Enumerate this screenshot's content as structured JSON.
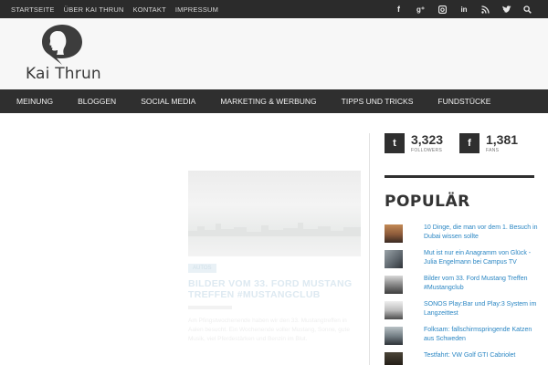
{
  "topbar": {
    "links": [
      "STARTSEITE",
      "ÜBER KAI THRUN",
      "KONTAKT",
      "IMPRESSUM"
    ],
    "social_icons": [
      "facebook-icon",
      "google-plus-icon",
      "instagram-icon",
      "linkedin-icon",
      "rss-icon",
      "twitter-icon",
      "search-icon"
    ],
    "social_glyphs": {
      "facebook": "f",
      "googleplus": "g⁺",
      "linkedin": "in"
    }
  },
  "header": {
    "site_name": "Kai Thrun"
  },
  "mainnav": {
    "items": [
      "MEINUNG",
      "BLOGGEN",
      "SOCIAL MEDIA",
      "MARKETING & WERBUNG",
      "TIPPS UND TRICKS",
      "FUNDSTÜCKE"
    ]
  },
  "article": {
    "badge": "AUTOS",
    "title": "BILDER VOM 33. FORD MUSTANG TREFFEN #MUSTANGCLUB",
    "excerpt": "Am Pfingstwochenende haben wir den 33. Mustangtreffen in Aalen besucht. Ein Wochenende voller Mustang, Sonne, gute Musik, viel Pferdestärken und Benzin im Blut."
  },
  "sidebar": {
    "twitter": {
      "glyph": "t",
      "count": "3,323",
      "label": "FOLLOWERS"
    },
    "facebook": {
      "glyph": "f",
      "count": "1,381",
      "label": "FANS"
    },
    "popular_title": "POPULÄR",
    "popular": [
      {
        "title": "10 Dinge, die man vor dem 1. Besuch in Dubai wissen sollte"
      },
      {
        "title": "Mut ist nur ein Anagramm von Glück - Julia Engelmann bei Campus TV"
      },
      {
        "title": "Bilder vom 33. Ford Mustang Treffen #Mustangclub"
      },
      {
        "title": "SONOS Play:Bar und Play:3 System im Langzeittest"
      },
      {
        "title": "Folksam: fallschirmspringende Katzen aus Schweden"
      },
      {
        "title": "Testfahrt: VW Golf GTI Cabriolet"
      }
    ]
  },
  "colors": {
    "topbar": "#2b2b2b",
    "header_bg": "#f7f7f7",
    "nav_bg": "#2f2f2f",
    "link": "#2a86c3"
  }
}
